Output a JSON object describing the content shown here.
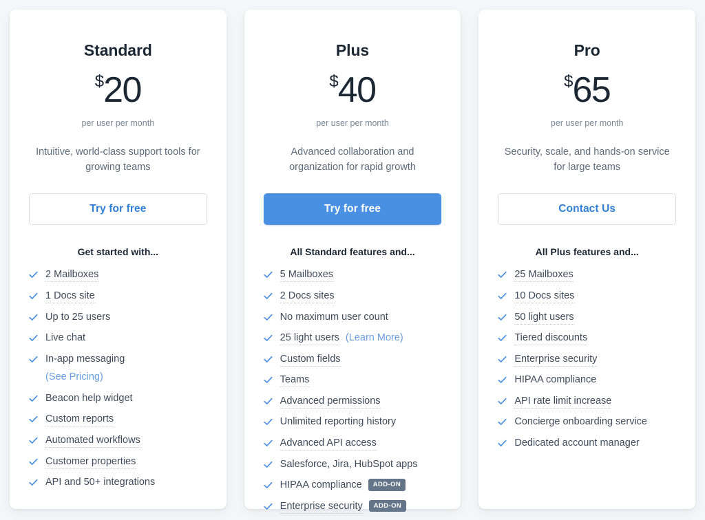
{
  "page": {
    "background_color": "#f5f6f9",
    "accent_color": "#4a90e2",
    "link_color": "#6a9fe0",
    "heading_color": "#1b2733",
    "badge_color": "#64758a"
  },
  "plans": [
    {
      "name": "Standard",
      "currency": "$",
      "amount": "20",
      "period": "per user per month",
      "description": "Intuitive, world-class support tools for growing teams",
      "cta": {
        "label": "Try for free",
        "style": "outline"
      },
      "features_heading": "Get started with...",
      "features": [
        {
          "text": "2 Mailboxes",
          "tooltip": true
        },
        {
          "text": "1 Docs site",
          "tooltip": true
        },
        {
          "text": "Up to 25 users",
          "tooltip": false
        },
        {
          "text": "Live chat",
          "tooltip": false
        },
        {
          "text": "In-app messaging",
          "tooltip": false,
          "sub_link": "(See Pricing)"
        },
        {
          "text": "Beacon help widget",
          "tooltip": false
        },
        {
          "text": "Custom reports",
          "tooltip": true
        },
        {
          "text": "Automated workflows",
          "tooltip": true
        },
        {
          "text": "Customer properties",
          "tooltip": true
        },
        {
          "text": "API and 50+ integrations",
          "tooltip": false
        }
      ]
    },
    {
      "name": "Plus",
      "currency": "$",
      "amount": "40",
      "period": "per user per month",
      "description": "Advanced collaboration and organization for rapid growth",
      "cta": {
        "label": "Try for free",
        "style": "filled"
      },
      "features_heading": "All Standard features and...",
      "features": [
        {
          "text": "5 Mailboxes",
          "tooltip": true
        },
        {
          "text": "2 Docs sites",
          "tooltip": true
        },
        {
          "text": "No maximum user count",
          "tooltip": false
        },
        {
          "text": "25 light users",
          "tooltip": true,
          "inline_link": "(Learn More)"
        },
        {
          "text": "Custom fields",
          "tooltip": true
        },
        {
          "text": "Teams",
          "tooltip": true
        },
        {
          "text": "Advanced permissions",
          "tooltip": true
        },
        {
          "text": "Unlimited reporting history",
          "tooltip": false
        },
        {
          "text": "Advanced API access",
          "tooltip": true
        },
        {
          "text": "Salesforce, Jira, HubSpot apps",
          "tooltip": false
        },
        {
          "text": "HIPAA compliance",
          "tooltip": false,
          "badge": "ADD-ON"
        },
        {
          "text": "Enterprise security",
          "tooltip": true,
          "badge": "ADD-ON"
        }
      ]
    },
    {
      "name": "Pro",
      "currency": "$",
      "amount": "65",
      "period": "per user per month",
      "description": "Security, scale, and hands-on service for large teams",
      "cta": {
        "label": "Contact Us",
        "style": "outline"
      },
      "features_heading": "All Plus features and...",
      "features": [
        {
          "text": "25 Mailboxes",
          "tooltip": true
        },
        {
          "text": "10 Docs sites",
          "tooltip": true
        },
        {
          "text": "50 light users",
          "tooltip": true
        },
        {
          "text": "Tiered discounts",
          "tooltip": true
        },
        {
          "text": "Enterprise security",
          "tooltip": true
        },
        {
          "text": "HIPAA compliance",
          "tooltip": false
        },
        {
          "text": "API rate limit increase",
          "tooltip": true
        },
        {
          "text": "Concierge onboarding service",
          "tooltip": false
        },
        {
          "text": "Dedicated account manager",
          "tooltip": false
        }
      ]
    }
  ],
  "icons": {
    "check": "check-icon"
  }
}
